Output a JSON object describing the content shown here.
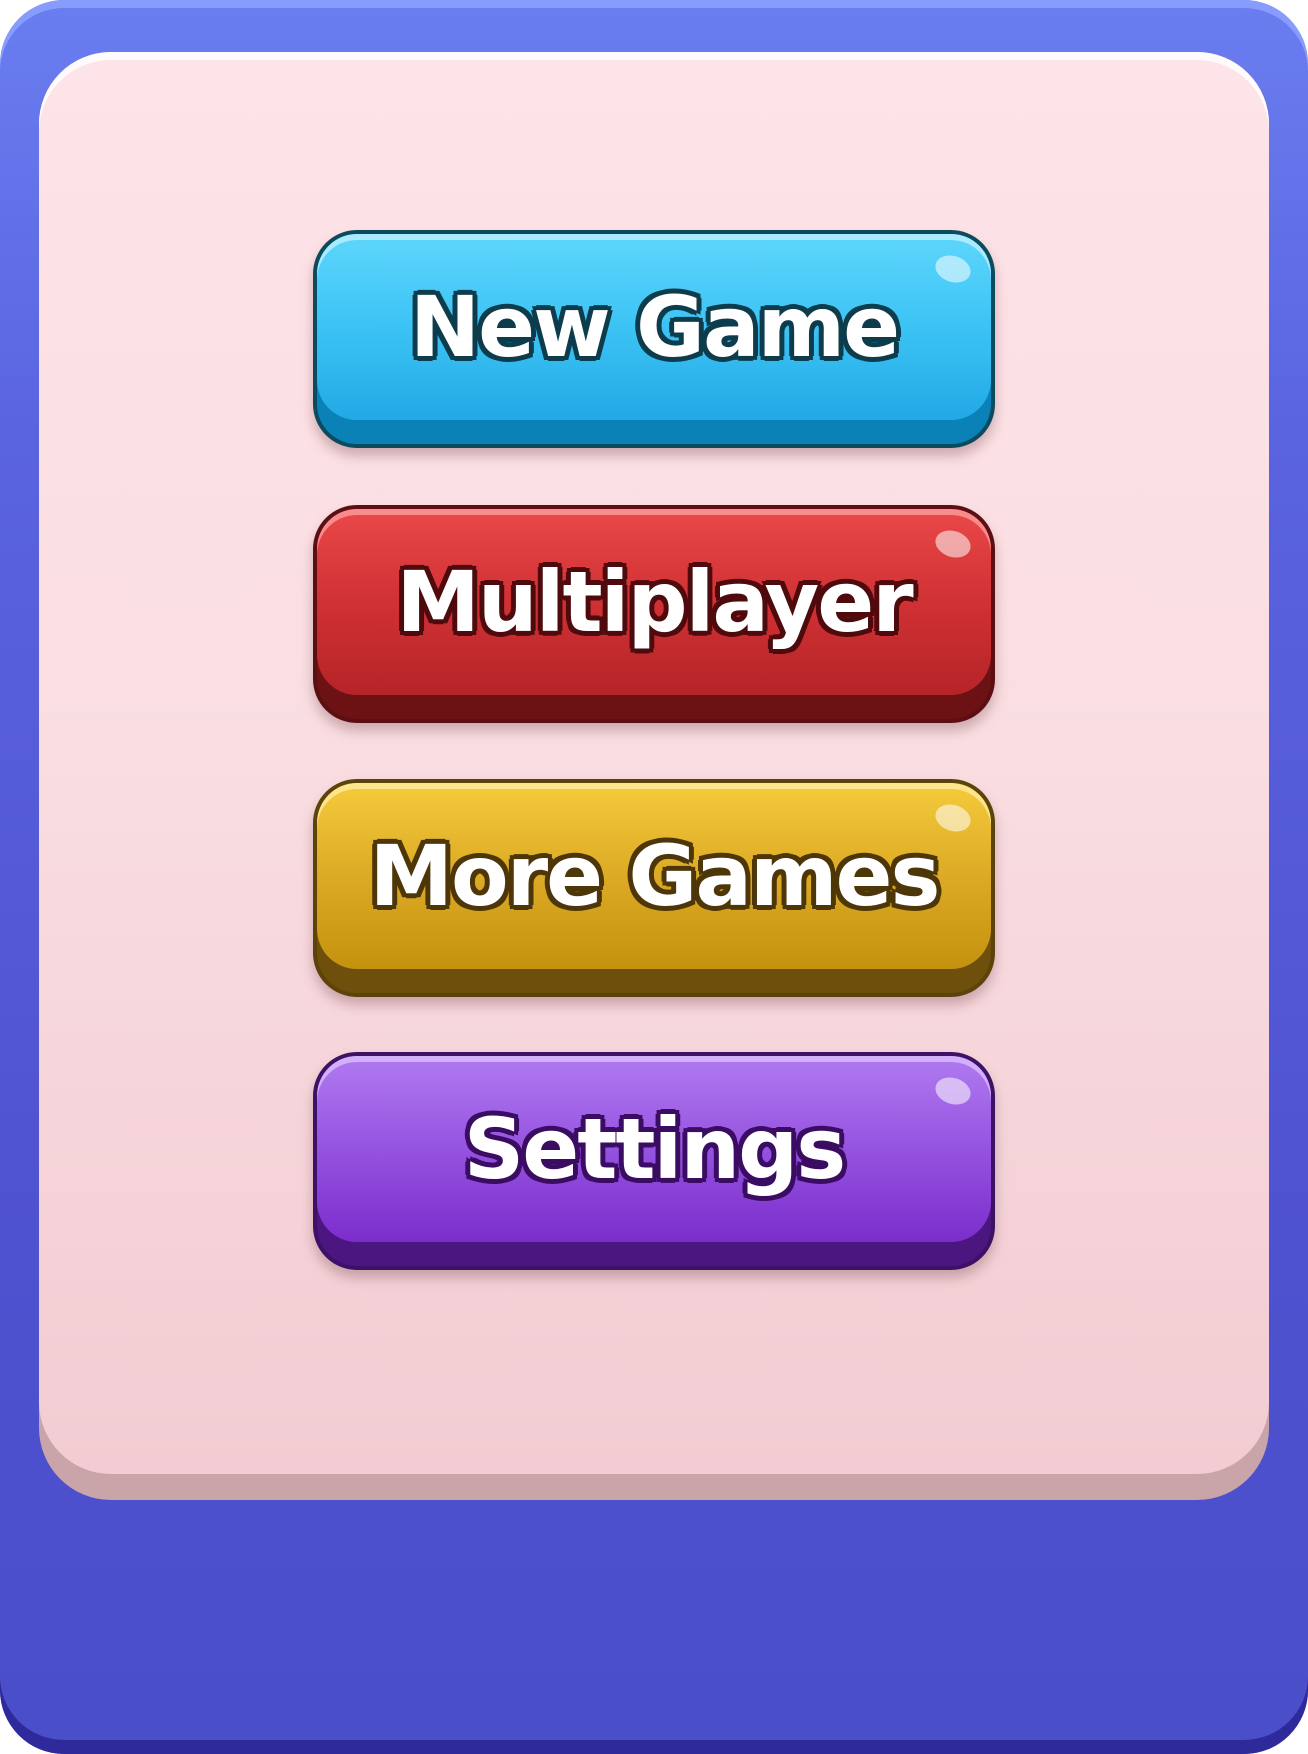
{
  "theme": {
    "frame_color": "#5562dc",
    "panel_color": "#fbe0e4"
  },
  "menu": {
    "buttons": [
      {
        "label": "New Game",
        "color": "#3cc3f4"
      },
      {
        "label": "Multiplayer",
        "color": "#d03134"
      },
      {
        "label": "More Games",
        "color": "#dcaa24"
      },
      {
        "label": "Settings",
        "color": "#9553e0"
      }
    ]
  }
}
